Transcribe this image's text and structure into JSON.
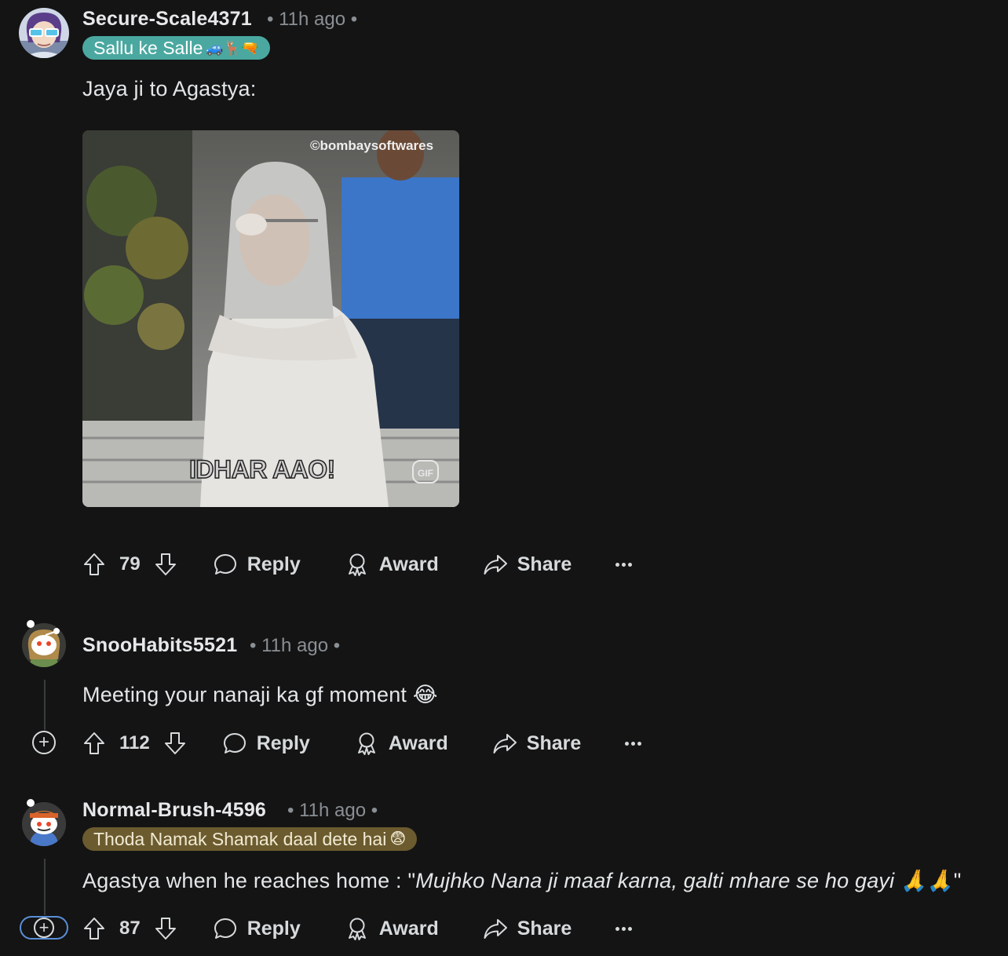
{
  "comments": [
    {
      "username": "Secure-Scale4371",
      "time": "11h ago",
      "flair": "Sallu ke Salle",
      "flair_emojis": "🚙🦌🔫",
      "text": "Jaya ji to Agastya:",
      "media": {
        "watermark": "©bombaysoftwares",
        "caption": "IDHAR AAO!",
        "badge": "GIF"
      },
      "votes": "79",
      "reply": "Reply",
      "award": "Award",
      "share": "Share"
    },
    {
      "username": "SnooHabits5521",
      "time": "11h ago",
      "text": "Meeting your nanaji ka gf moment 😂",
      "votes": "112",
      "reply": "Reply",
      "award": "Award",
      "share": "Share"
    },
    {
      "username": "Normal-Brush-4596",
      "time": "11h ago",
      "flair": "Thoda Namak Shamak daal dete hai",
      "flair_emojis": "😨",
      "text_before": "Agastya when he reaches home : \"",
      "text_italic": "Mujhko Nana ji maaf karna, galti mhare se ho gayi 🙏🙏",
      "text_after": "\"",
      "votes": "87",
      "reply": "Reply",
      "award": "Award",
      "share": "Share"
    }
  ],
  "colors": {
    "background": "#141414",
    "teal_flair": "#4aa8a0",
    "olive_flair": "#6b5b2e",
    "thread_line": "#3a3d40",
    "focus_ring": "#5a8fd8"
  }
}
